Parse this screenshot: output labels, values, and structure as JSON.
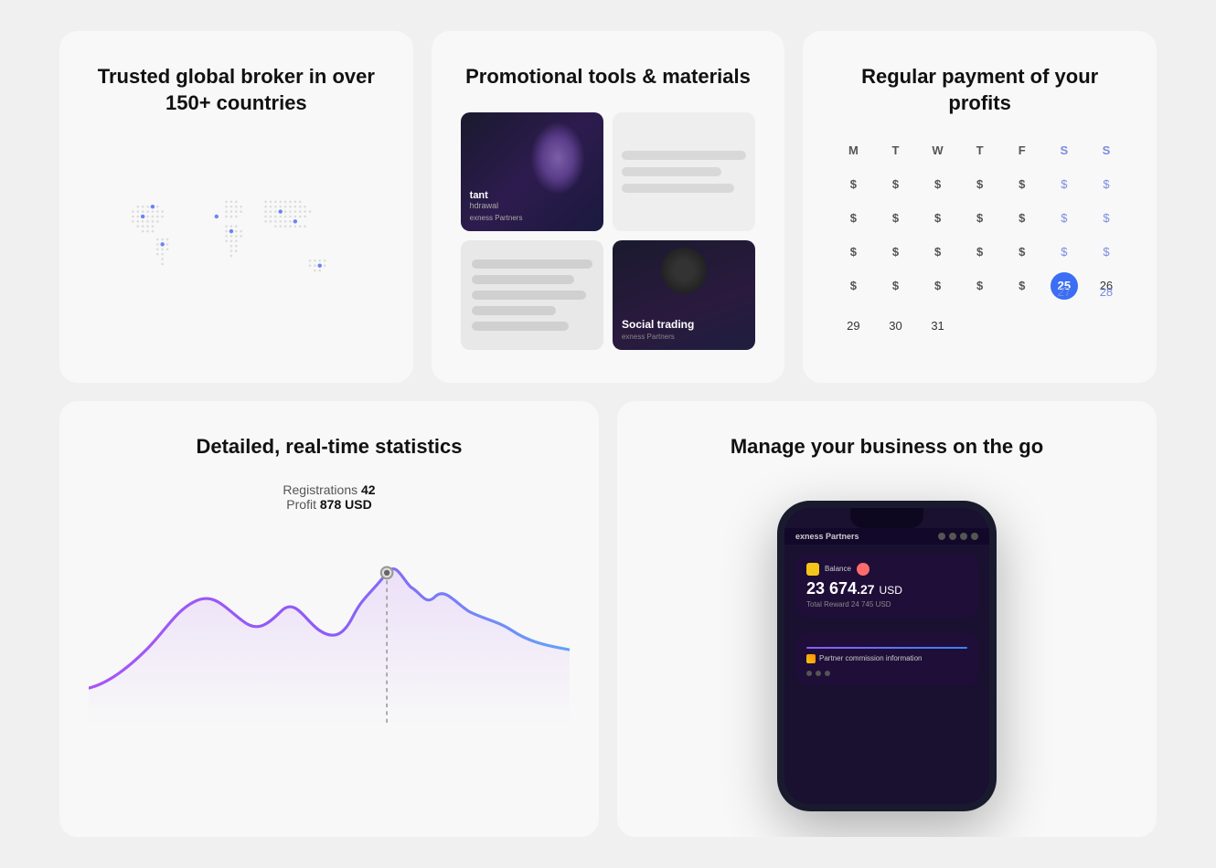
{
  "cards": {
    "card1": {
      "title": "Trusted global broker in over 150+ countries"
    },
    "card2": {
      "title": "Promotional tools & materials",
      "banner_text": "tant",
      "banner_subtext": "hdrawal",
      "banner_logo": "exness Partners",
      "social_label": "Social trading",
      "social_logo": "exness Partners"
    },
    "card3": {
      "title": "Regular payment of your profits",
      "days": [
        "M",
        "T",
        "W",
        "T",
        "F",
        "S",
        "S"
      ],
      "today_date": "25",
      "highlight_dates": [
        "26",
        "27",
        "28"
      ],
      "dates_row5": [
        "29",
        "30",
        "31"
      ]
    },
    "card4": {
      "title": "Detailed, real-time statistics",
      "registrations_label": "Registrations",
      "registrations_value": "42",
      "profit_label": "Profit",
      "profit_value": "878 USD"
    },
    "card5": {
      "title": "Manage your business on the go",
      "brand": "exness Partners",
      "balance_label": "Balance",
      "amount": "23 674",
      "amount_decimal": ".27",
      "amount_currency": "USD",
      "total_reward": "Total Reward 24 745 USD",
      "commission_label": "Partner commission information"
    }
  }
}
